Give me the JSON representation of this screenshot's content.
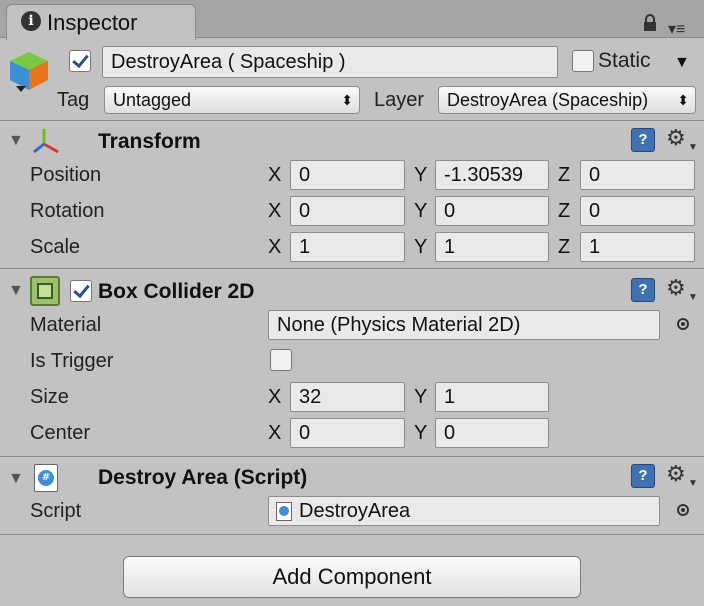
{
  "tab": {
    "title": "Inspector",
    "icon": "info-icon"
  },
  "gameobject": {
    "active": true,
    "name": "DestroyArea ( Spaceship )",
    "static_label": "Static",
    "static_checked": false,
    "tag_label": "Tag",
    "tag_value": "Untagged",
    "layer_label": "Layer",
    "layer_value": "DestroyArea (Spaceship)"
  },
  "transform": {
    "title": "Transform",
    "rows": [
      {
        "label": "Position",
        "x": "0",
        "y": "-1.30539",
        "z": "0"
      },
      {
        "label": "Rotation",
        "x": "0",
        "y": "0",
        "z": "0"
      },
      {
        "label": "Scale",
        "x": "1",
        "y": "1",
        "z": "1"
      }
    ]
  },
  "box_collider": {
    "title": "Box Collider 2D",
    "enabled": true,
    "material_label": "Material",
    "material_value": "None (Physics Material 2D)",
    "trigger_label": "Is Trigger",
    "trigger_checked": false,
    "size_label": "Size",
    "size_x": "32",
    "size_y": "1",
    "center_label": "Center",
    "center_x": "0",
    "center_y": "0"
  },
  "script_component": {
    "title": "Destroy Area (Script)",
    "script_label": "Script",
    "script_value": "DestroyArea"
  },
  "axis": {
    "x": "X",
    "y": "Y",
    "z": "Z"
  },
  "add_component_label": "Add Component",
  "colors": {
    "panel": "#c2c2c2",
    "field": "#e9e9e9",
    "accent": "#3f72b2"
  }
}
